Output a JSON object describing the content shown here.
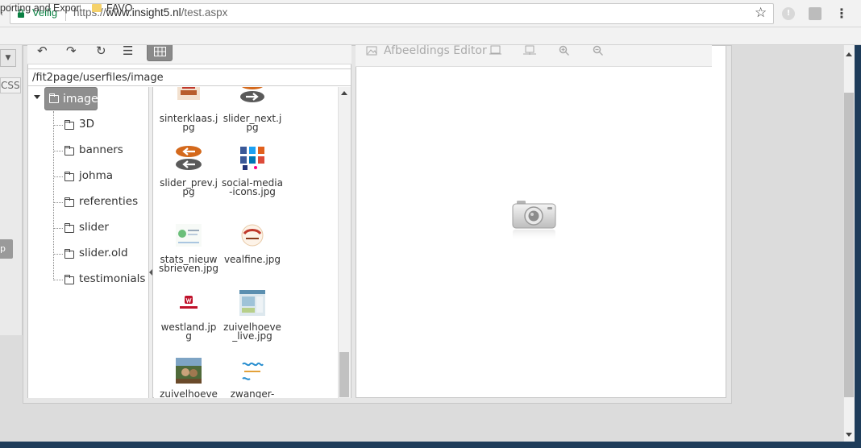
{
  "browser": {
    "secure_label": "Veilig",
    "url_scheme": "https://",
    "url_host": "www.insight5.nl",
    "url_path": "/test.aspx",
    "bookmarks": [
      {
        "label_visible": "porting and Export",
        "label_faded": "i"
      },
      {
        "label": "FAVO"
      }
    ]
  },
  "left_panel": {
    "css_label": "CSS",
    "button_fragment": "p"
  },
  "file_browser": {
    "path": "/fit2page/userfiles/image",
    "tree": {
      "root": "image",
      "children": [
        "3D",
        "banners",
        "johma",
        "referenties",
        "slider",
        "slider.old",
        "testimonials"
      ]
    },
    "files": [
      {
        "name": "sinterklaas.jpg",
        "thumb": "sinterklaas-thumb"
      },
      {
        "name": "slider_next.jpg",
        "thumb": "arrow-next-thumb"
      },
      {
        "name": "slider_prev.jpg",
        "thumb": "arrow-prev-thumb"
      },
      {
        "name": "social-media-icons.jpg",
        "thumb": "social-icons-thumb"
      },
      {
        "name": "stats_nieuwsbrieven.jpg",
        "thumb": "stats-thumb"
      },
      {
        "name": "vealfine.jpg",
        "thumb": "vealfine-logo-thumb"
      },
      {
        "name": "westland.jpg",
        "thumb": "westland-logo-thumb"
      },
      {
        "name": "zuivelhoeve_live.jpg",
        "thumb": "website-screenshot-thumb"
      },
      {
        "name": "zuivelhoeve",
        "thumb": "photo-thumb"
      },
      {
        "name": "zwanger-",
        "thumb": "zwanger-logo-thumb"
      }
    ]
  },
  "editor": {
    "title": "Afbeeldings Editor"
  },
  "colors": {
    "secure_green": "#0b8043",
    "selected_folder": "#8e8e8e",
    "window_frame": "#1e3c5a"
  }
}
